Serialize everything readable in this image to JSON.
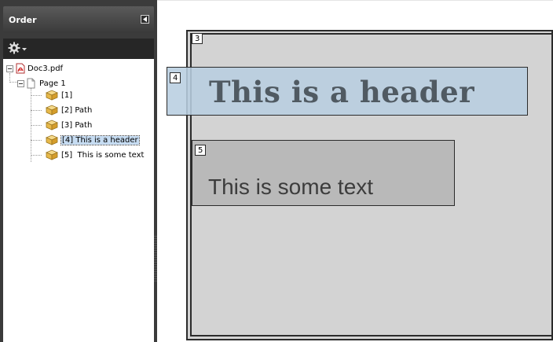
{
  "panel": {
    "title": "Order",
    "options_icon": "gear-icon",
    "collapse_icon": "triangle-left-icon"
  },
  "tree": {
    "root": {
      "label": "Doc3.pdf",
      "icon": "pdf-icon",
      "expanded": true
    },
    "page": {
      "label": "Page 1",
      "icon": "page-icon",
      "expanded": true
    },
    "items": [
      {
        "label": "[1]",
        "icon": "container-icon",
        "selected": false
      },
      {
        "label": "[2] Path",
        "icon": "container-icon",
        "selected": false
      },
      {
        "label": "[3] Path",
        "icon": "container-icon",
        "selected": false
      },
      {
        "label": "[4] This is a header",
        "icon": "container-icon",
        "selected": true
      },
      {
        "label": "[5]  This is some text",
        "icon": "container-icon",
        "selected": false
      }
    ]
  },
  "document": {
    "page_tag": "3",
    "header_tag": "4",
    "header_text": "This is a header",
    "text_tag": "5",
    "body_text": "This is some text"
  },
  "colors": {
    "panel_bg": "#3b3b3b",
    "selection": "#c6dcf2",
    "header_highlight": "#b8cee0",
    "page_bg": "#d3d3d3",
    "text_box_bg": "#b9b9b9"
  }
}
